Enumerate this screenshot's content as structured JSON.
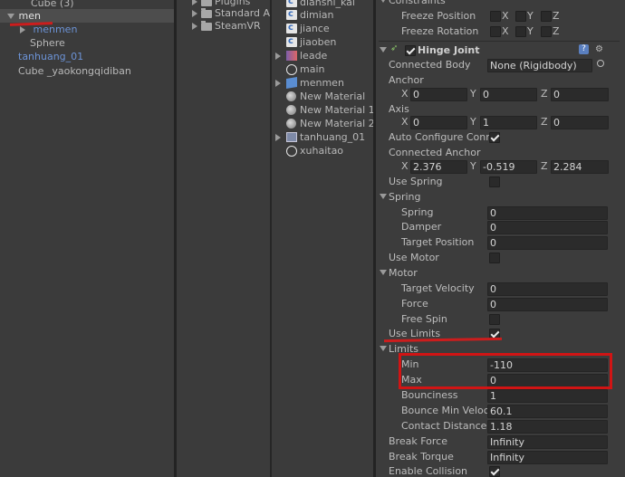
{
  "hierarchy": {
    "items": [
      {
        "label": "Cube (3)"
      },
      {
        "label": "men"
      },
      {
        "label": "menmen"
      },
      {
        "label": "Sphere"
      },
      {
        "label": "tanhuang_01"
      },
      {
        "label": "Cube _yaokongqidiban"
      }
    ]
  },
  "project_tree": {
    "folders": [
      "Plugins",
      "Standard A",
      "SteamVR"
    ]
  },
  "project_files": {
    "items": [
      "dianshi_kai",
      "dimian",
      "jiance",
      "jiaoben",
      "leade",
      "main",
      "menmen",
      "New Material",
      "New Material 1",
      "New Material 2",
      "tanhuang_01",
      "xuhaitao"
    ]
  },
  "inspector": {
    "constraints_header": "Constraints",
    "freeze_position": "Freeze Position",
    "freeze_rotation": "Freeze Rotation",
    "axis_x": "X",
    "axis_y": "Y",
    "axis_z": "Z",
    "component_title": "Hinge Joint",
    "connected_body_label": "Connected Body",
    "connected_body_value": "None (Rigidbody)",
    "anchor_label": "Anchor",
    "anchor": {
      "x": "0",
      "y": "0",
      "z": "0"
    },
    "axis_label": "Axis",
    "axis": {
      "x": "0",
      "y": "1",
      "z": "0"
    },
    "auto_configure_label": "Auto Configure Conr",
    "auto_configure": true,
    "connected_anchor_label": "Connected Anchor",
    "connected_anchor": {
      "x": "2.376",
      "y": "-0.519",
      "z": "2.284"
    },
    "use_spring_label": "Use Spring",
    "use_spring": false,
    "spring_label": "Spring",
    "spring": {
      "spring_label": "Spring",
      "spring": "0",
      "damper_label": "Damper",
      "damper": "0",
      "target_position_label": "Target Position",
      "target_position": "0"
    },
    "use_motor_label": "Use Motor",
    "use_motor": false,
    "motor_label": "Motor",
    "motor": {
      "target_velocity_label": "Target Velocity",
      "target_velocity": "0",
      "force_label": "Force",
      "force": "0",
      "free_spin_label": "Free Spin",
      "free_spin": false
    },
    "use_limits_label": "Use Limits",
    "use_limits": true,
    "limits_label": "Limits",
    "limits": {
      "min_label": "Min",
      "min": "-110",
      "max_label": "Max",
      "max": "0",
      "bounciness_label": "Bounciness",
      "bounciness": "1",
      "bounce_min_label": "Bounce Min Veloci",
      "bounce_min": "60.1",
      "contact_distance_label": "Contact Distance",
      "contact_distance": "1.18"
    },
    "break_force_label": "Break Force",
    "break_force": "Infinity",
    "break_torque_label": "Break Torque",
    "break_torque": "Infinity",
    "enable_collision_label": "Enable Collision",
    "enable_collision": true
  },
  "colors": {
    "annotation": "#d11414",
    "selection": "#4d4d4d",
    "prefab_text": "#6c93d6"
  }
}
